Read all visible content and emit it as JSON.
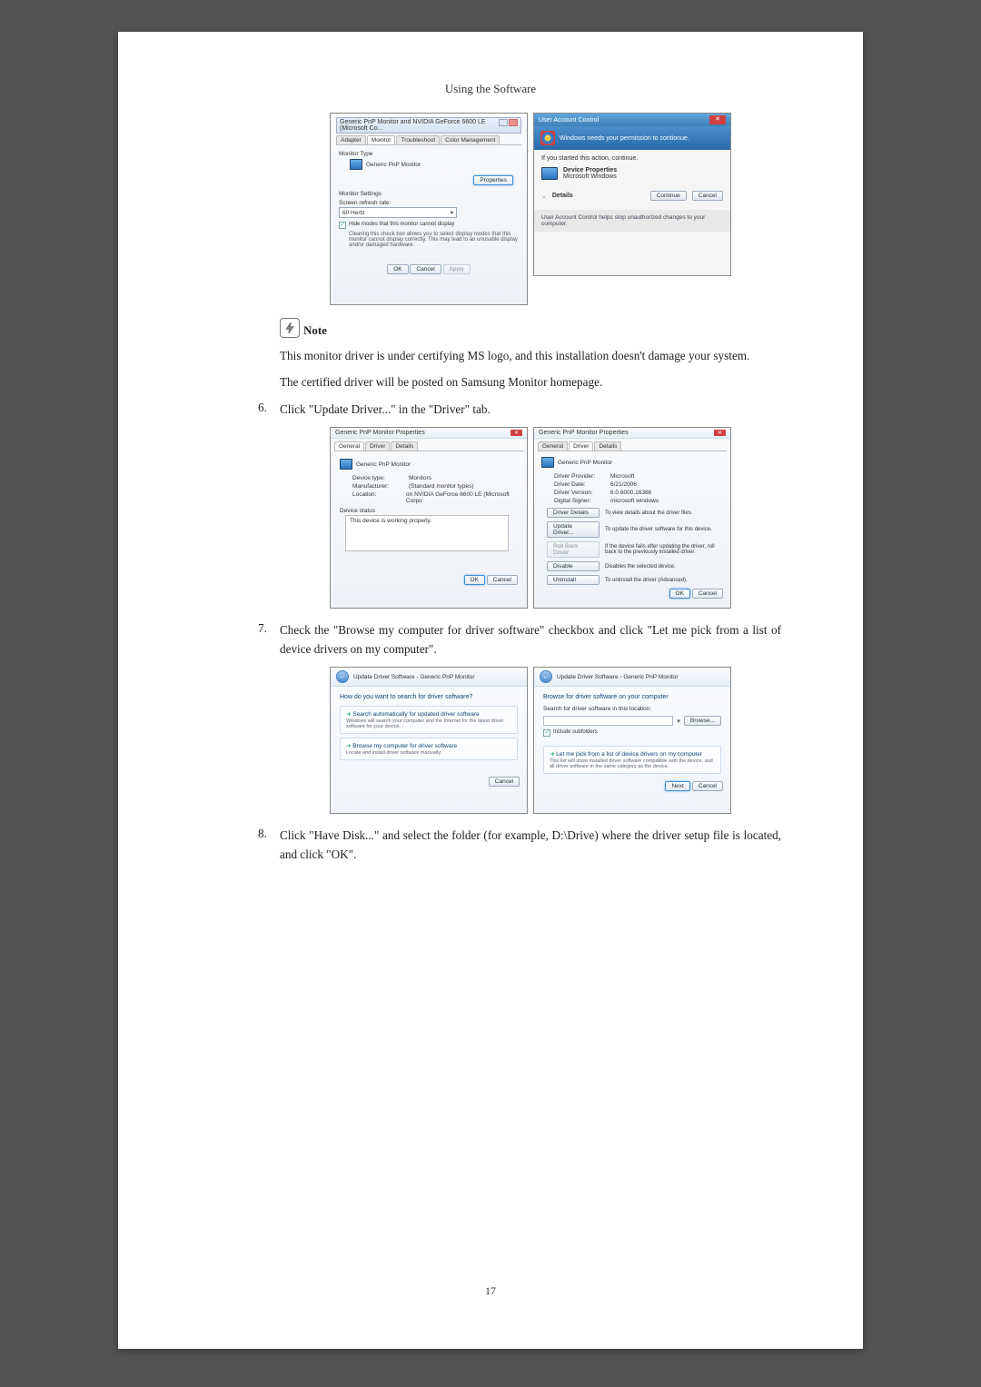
{
  "header": "Using the Software",
  "screenshot1": {
    "title": "Generic PnP Monitor and NVIDIA GeForce 6600 LE (Microsoft Co...",
    "tabs": [
      "Adapter",
      "Monitor",
      "Troubleshoot",
      "Color Management"
    ],
    "monitor_type_label": "Monitor Type",
    "monitor_name": "Generic PnP Monitor",
    "properties_btn": "Properties",
    "monitor_settings_label": "Monitor Settings",
    "refresh_label": "Screen refresh rate:",
    "refresh_val": "60 Hertz",
    "hide_modes": "Hide modes that this monitor cannot display",
    "hide_desc": "Clearing this check box allows you to select display modes that this monitor cannot display correctly. This may lead to an unusable display and/or damaged hardware.",
    "ok": "OK",
    "cancel": "Cancel",
    "apply": "Apply"
  },
  "screenshot2": {
    "title": "User Account Control",
    "banner": "Windows needs your permission to contionue.",
    "started": "If you started this action, continue.",
    "item_name": "Device Properties",
    "item_vendor": "Microsoft Windows",
    "details": "Details",
    "continue": "Continue",
    "cancel": "Cancel",
    "footer": "User Account Control helps stop unauthorized changes to your computer."
  },
  "note_label": "Note",
  "note_text1": "This monitor driver is under certifying MS logo, and this installation doesn't damage your system.",
  "note_text2": "The certified driver will be posted on Samsung Monitor homepage.",
  "step6_num": "6.",
  "step6_text": "Click \"Update Driver...\" in the \"Driver\" tab.",
  "screenshot3": {
    "title": "Generic PnP Monitor Properties",
    "tabs": [
      "General",
      "Driver",
      "Details"
    ],
    "monitor_name": "Generic PnP Monitor",
    "device_type": "Device type:",
    "device_type_val": "Monitors",
    "manufacturer": "Manufacturer:",
    "manufacturer_val": "(Standard monitor types)",
    "location": "Location:",
    "location_val": "on NVIDIA GeForce 6600 LE (Microsoft Corpo",
    "device_status": "Device status",
    "status_text": "This device is working properly.",
    "ok": "OK",
    "cancel": "Cancel"
  },
  "screenshot4": {
    "title": "Generic PnP Monitor Properties",
    "tabs": [
      "General",
      "Driver",
      "Details"
    ],
    "monitor_name": "Generic PnP Monitor",
    "provider": "Driver Provider:",
    "provider_val": "Microsoft",
    "date": "Driver Date:",
    "date_val": "6/21/2006",
    "version": "Driver Version:",
    "version_val": "6.0.6000.16386",
    "signer": "Digital Signer:",
    "signer_val": "microsoft windows",
    "btn_details": "Driver Details",
    "btn_details_desc": "To view details about the driver files.",
    "btn_update": "Update Driver...",
    "btn_update_desc": "To update the driver software for this device.",
    "btn_rollback": "Roll Back Driver",
    "btn_rollback_desc": "If the device fails after updating the driver, roll back to the previously installed driver.",
    "btn_disable": "Disable",
    "btn_disable_desc": "Disables the selected device.",
    "btn_uninstall": "Uninstall",
    "btn_uninstall_desc": "To uninstall the driver (Advanced).",
    "ok": "OK",
    "cancel": "Cancel"
  },
  "step7_num": "7.",
  "step7_text": "Check the \"Browse my computer for driver software\" checkbox and click \"Let me pick from a list of device drivers on my computer\".",
  "screenshot5": {
    "breadcrumb": "Update Driver Software - Generic PnP Monitor",
    "heading": "How do you want to search for driver software?",
    "opt1_title": "Search automatically for updated driver software",
    "opt1_desc": "Windows will search your computer and the Internet for the latest driver software for your device.",
    "opt2_title": "Browse my computer for driver software",
    "opt2_desc": "Locate and install driver software manually.",
    "cancel": "Cancel"
  },
  "screenshot6": {
    "breadcrumb": "Update Driver Software - Generic PnP Monitor",
    "heading": "Browse for driver software on your computer",
    "search_label": "Search for driver software in this location:",
    "browse": "Browse...",
    "include_sub": "Include subfolders",
    "opt_title": "Let me pick from a list of device drivers on my computer",
    "opt_desc": "This list will show installed driver software compatible with the device, and all driver software in the same category as the device.",
    "next": "Next",
    "cancel": "Cancel"
  },
  "step8_num": "8.",
  "step8_text": "Click \"Have Disk...\" and select the folder (for example, D:\\Drive) where the driver setup file is located, and click \"OK\".",
  "page_number": "17"
}
